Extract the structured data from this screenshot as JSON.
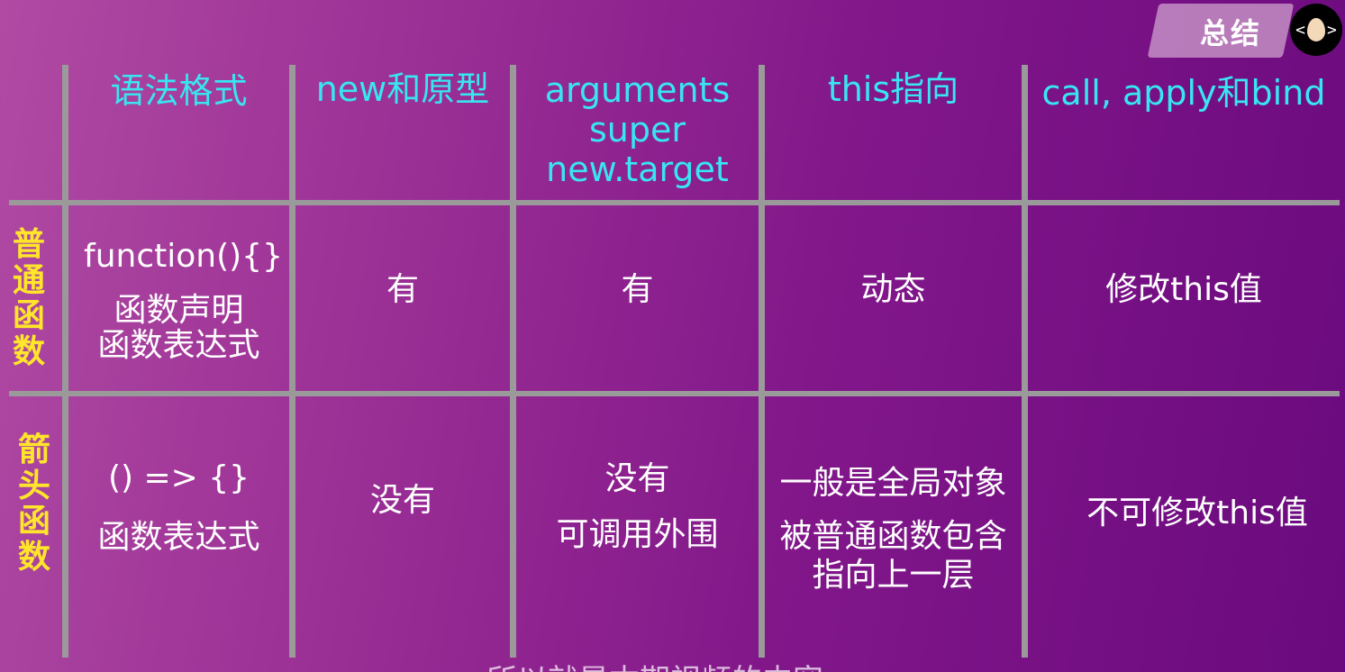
{
  "badge": {
    "label": "总结"
  },
  "logo": {
    "left": "<",
    "right": ">"
  },
  "headers": {
    "syntax": "语法格式",
    "new_proto": "new和原型",
    "arguments": [
      "arguments",
      "super",
      "new.target"
    ],
    "this": "this指向",
    "call": "call, apply和bind"
  },
  "rows": {
    "normal": {
      "label": [
        "普",
        "通",
        "函",
        "数"
      ],
      "syntax": [
        "function(){}",
        "函数声明",
        "函数表达式"
      ],
      "new_proto": "有",
      "arguments": "有",
      "this": "动态",
      "call": "修改this值"
    },
    "arrow": {
      "label": [
        "箭",
        "头",
        "函",
        "数"
      ],
      "syntax": [
        "() => {}",
        "函数表达式"
      ],
      "new_proto": "没有",
      "arguments": [
        "没有",
        "可调用外围"
      ],
      "this": [
        "一般是全局对象",
        "被普通函数包含",
        "指向上一层"
      ],
      "call": "不可修改this值"
    }
  },
  "subtitle": "所以就是本期视频的内容"
}
